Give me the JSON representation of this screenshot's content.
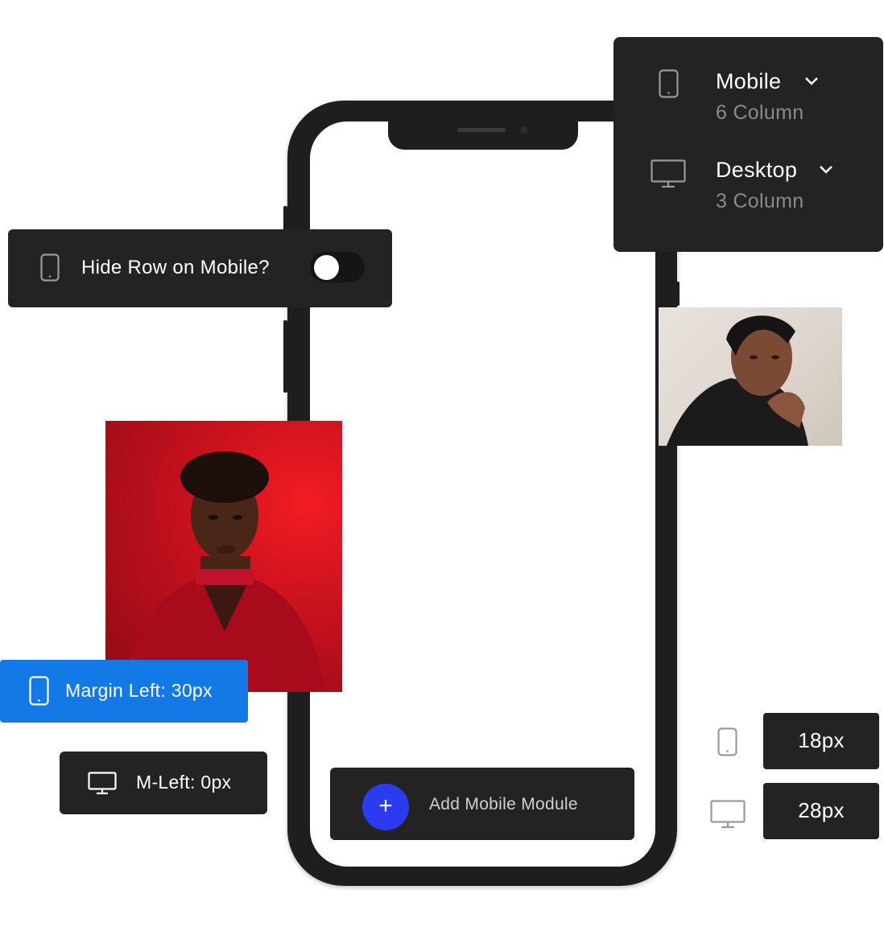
{
  "device_selector": {
    "mobile": {
      "label": "Mobile",
      "columns": "6 Column",
      "icon": "smartphone-icon"
    },
    "desktop": {
      "label": "Desktop",
      "columns": "3 Column",
      "icon": "monitor-icon"
    }
  },
  "hide_row": {
    "label": "Hide Row on Mobile?",
    "icon": "smartphone-icon",
    "toggle_on": false
  },
  "margin": {
    "mobile_label": "Margin Left: 30px",
    "desktop_label": "M-Left: 0px",
    "accent_color": "#1379e6"
  },
  "add_module": {
    "label": "Add Mobile Module",
    "button_symbol": "+",
    "button_color": "#2b3cf0"
  },
  "font_sizes": {
    "mobile_value": "18px",
    "desktop_value": "28px"
  }
}
